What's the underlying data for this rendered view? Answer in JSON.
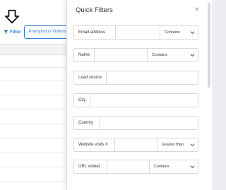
{
  "background": {
    "filter_label": "Filter",
    "anonymous_visitors_label": "Anonymous Visitors"
  },
  "panel": {
    "title": "Quick Filters",
    "close_symbol": "×",
    "filters": [
      {
        "label": "Email address",
        "operator": "Contains"
      },
      {
        "label": "Name",
        "operator": "Contains"
      },
      {
        "label": "Lead source"
      },
      {
        "label": "City"
      },
      {
        "label": "Country"
      },
      {
        "label": "Website visits #",
        "operator": "Greater than"
      },
      {
        "label": "URL visited",
        "operator": "Contains"
      }
    ]
  },
  "colors": {
    "accent": "#2f7bd6",
    "border": "#d6d9de"
  }
}
